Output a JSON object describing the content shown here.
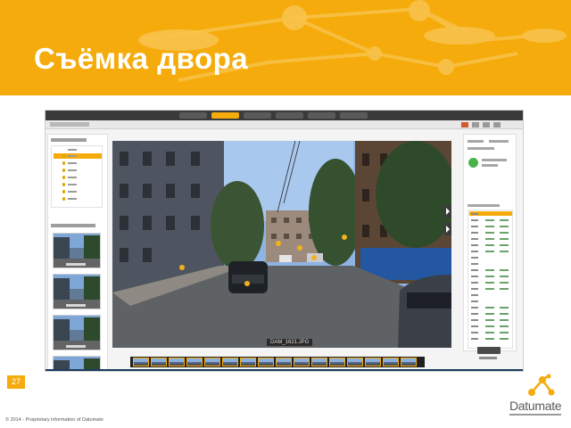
{
  "slide": {
    "title": "Съёмка двора",
    "page_number": "27",
    "copyright": "© 2014 - Proprietary information of Datumate"
  },
  "logo": {
    "name": "Datumate"
  },
  "app": {
    "view_caption": "DAM_1621.JPG"
  },
  "colors": {
    "brand_orange": "#f5ab0b",
    "status_green": "#49b34a",
    "app_dark": "#3a3a3a"
  }
}
